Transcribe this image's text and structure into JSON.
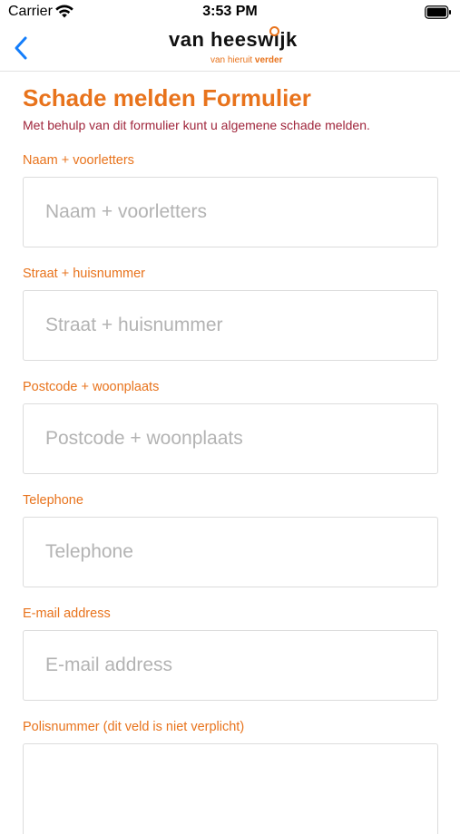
{
  "status_bar": {
    "carrier": "Carrier",
    "time": "3:53 PM"
  },
  "nav": {
    "back_icon": "chevron-left-icon",
    "logo_name": "van heeswijk",
    "logo_tagline_regular": "van hieruit",
    "logo_tagline_bold": "verder"
  },
  "form": {
    "title": "Schade melden Formulier",
    "description": "Met behulp van dit formulier kunt u algemene schade melden.",
    "fields": [
      {
        "label": "Naam + voorletters",
        "placeholder": "Naam + voorletters",
        "value": ""
      },
      {
        "label": "Straat + huisnummer",
        "placeholder": "Straat + huisnummer",
        "value": ""
      },
      {
        "label": "Postcode + woonplaats",
        "placeholder": "Postcode + woonplaats",
        "value": ""
      },
      {
        "label": "Telephone",
        "placeholder": "Telephone",
        "value": ""
      },
      {
        "label": "E-mail address",
        "placeholder": "E-mail address",
        "value": ""
      },
      {
        "label": "Polisnummer (dit veld is niet verplicht)",
        "placeholder": "",
        "value": ""
      }
    ]
  },
  "colors": {
    "accent_orange": "#e8731c",
    "description_red": "#a0263c",
    "ios_blue": "#147efb",
    "input_border": "#dcdcdc",
    "placeholder_gray": "#b3b3b3"
  }
}
